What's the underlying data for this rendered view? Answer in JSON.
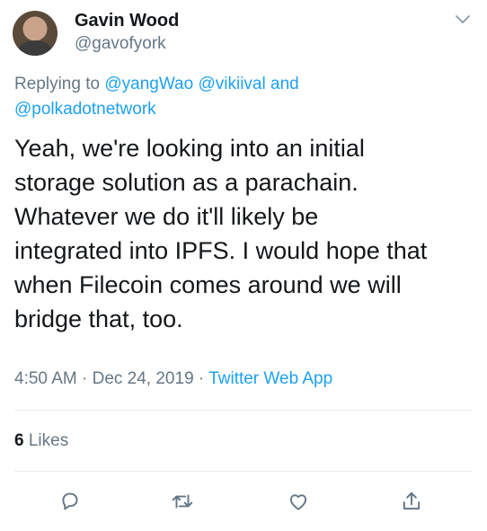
{
  "author": {
    "name": "Gavin Wood",
    "handle": "@gavofyork"
  },
  "reply": {
    "prefix": "Replying to",
    "mentions": [
      "@yangWao",
      "@vikiival",
      "@polkadotnetwork"
    ],
    "conjunction": "and"
  },
  "tweet": {
    "text": "Yeah, we're looking into an initial\nstorage solution as a parachain.\nWhatever we do it'll likely be\nintegrated into IPFS. I would hope that\nwhen Filecoin comes around we will\nbridge that, too."
  },
  "meta": {
    "time": "4:50 AM",
    "separator": "·",
    "date": "Dec 24, 2019",
    "source": "Twitter Web App"
  },
  "stats": {
    "likes_count": "6",
    "likes_label": "Likes"
  },
  "icons": {
    "menu": "chevron-down-icon",
    "reply": "reply-icon",
    "retweet": "retweet-icon",
    "like": "heart-icon",
    "share": "share-icon"
  },
  "colors": {
    "text": "#14171a",
    "secondary": "#657786",
    "link": "#1da1f2",
    "divider": "#e6ecf0"
  }
}
